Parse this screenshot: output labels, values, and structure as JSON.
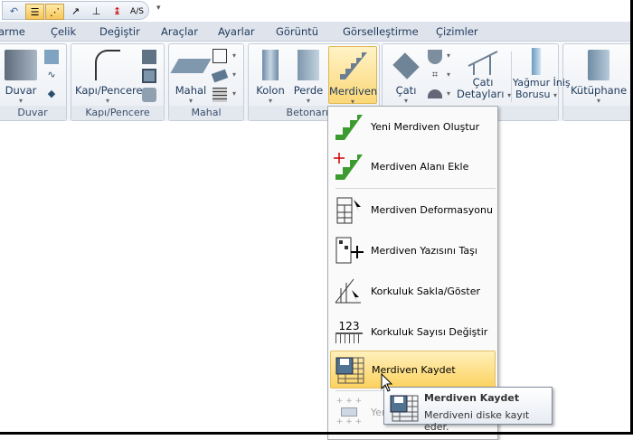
{
  "quick_access": {
    "items": [
      "undo-icon",
      "layer-list-icon",
      "snap-icon",
      "line-point-icon",
      "perp-point-icon",
      "elevation-icon",
      "area-scale-icon"
    ],
    "as_label": "A/S",
    "customize": "▾"
  },
  "tabs": [
    "arme",
    "Çelik",
    "Değiştir",
    "Araçlar",
    "Ayarlar",
    "Görüntü",
    "Görselleştirme",
    "Çizimler"
  ],
  "ribbon": {
    "groups": {
      "duvar": "Duvar",
      "kapi": "Kapı/Pencere",
      "mahal": "Mahal",
      "betonarme": "Betonarme",
      "kutuphane": ""
    },
    "buttons": {
      "duvar": "Duvar",
      "kapi": "Kapı/Pencere",
      "mahal": "Mahal",
      "kolon": "Kolon",
      "perde": "Perde",
      "merdiven": "Merdiven",
      "cati": "Çatı",
      "cati_det1": "Çatı",
      "cati_det2": "Detayları",
      "yagmur1": "Yağmur İniş",
      "yagmur2": "Borusu",
      "kutuphane": "Kütüphane"
    }
  },
  "menu": {
    "items": [
      {
        "label": "Yeni Merdiven Oluştur",
        "icon": "new-stair-icon"
      },
      {
        "label": "Merdiven Alanı Ekle",
        "icon": "stair-area-icon"
      },
      {
        "label": "Merdiven Deformasyonu",
        "icon": "stair-deform-icon"
      },
      {
        "label": "Merdiven Yazısını Taşı",
        "icon": "move-text-icon"
      },
      {
        "label": "Korkuluk Sakla/Göster",
        "icon": "railing-toggle-icon"
      },
      {
        "label": "Korkuluk Sayısı Değiştir",
        "icon": "railing-count-icon",
        "icon_text": "123"
      },
      {
        "label": "Merdiven Kaydet",
        "icon": "save-stair-icon"
      },
      {
        "label": "Yerl",
        "icon": "place-icon"
      }
    ]
  },
  "tooltip": {
    "title": "Merdiven Kaydet",
    "desc": "Merdiveni diske kayıt eder."
  },
  "colors": {
    "accent": "#fcd25f",
    "stair_green": "#3c9b2e"
  }
}
